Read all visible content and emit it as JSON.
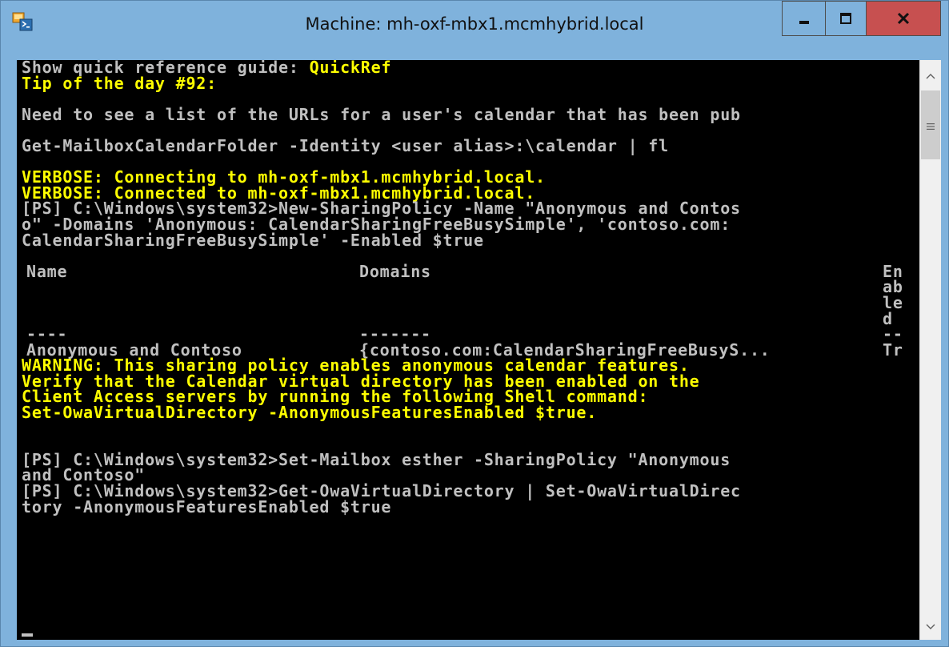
{
  "window": {
    "title": "Machine: mh-oxf-mbx1.mcmhybrid.local",
    "icon": "powershell-console-icon",
    "controls": [
      "minimize-icon",
      "maximize-icon",
      "close-icon"
    ],
    "colors": {
      "titlebar": "#7fb2dc",
      "close": "#c75050",
      "console_bg": "#000000",
      "text_default": "#c0c0c0",
      "text_yellow": "#ffff00"
    }
  },
  "console": {
    "lines": [
      {
        "segments": [
          {
            "text": "Show quick reference guide: ",
            "color": "w"
          },
          {
            "text": "QuickRef",
            "color": "y"
          }
        ]
      },
      {
        "segments": [
          {
            "text": "Tip of the day #92:",
            "color": "y"
          }
        ]
      },
      {
        "segments": []
      },
      {
        "segments": [
          {
            "text": "Need to see a list of the URLs for a user's calendar that has been pub",
            "color": "w"
          }
        ]
      },
      {
        "segments": []
      },
      {
        "segments": [
          {
            "text": "Get-MailboxCalendarFolder -Identity <user alias>:\\calendar | fl",
            "color": "w"
          }
        ]
      },
      {
        "segments": []
      },
      {
        "segments": [
          {
            "text": "VERBOSE: Connecting to mh-oxf-mbx1.mcmhybrid.local.",
            "color": "y"
          }
        ]
      },
      {
        "segments": [
          {
            "text": "VERBOSE: Connected to mh-oxf-mbx1.mcmhybrid.local.",
            "color": "y"
          }
        ]
      },
      {
        "segments": [
          {
            "text": "[PS] C:\\Windows\\system32>New-SharingPolicy -Name \"Anonymous and Contos",
            "color": "w"
          }
        ]
      },
      {
        "segments": [
          {
            "text": "o\" -Domains 'Anonymous: CalendarSharingFreeBusySimple', 'contoso.com:",
            "color": "w"
          }
        ]
      },
      {
        "segments": [
          {
            "text": "CalendarSharingFreeBusySimple' -Enabled $true",
            "color": "w"
          }
        ]
      },
      {
        "segments": []
      }
    ],
    "table": {
      "headers": {
        "name": "Name",
        "domains": "Domains",
        "enabled": [
          "En",
          "ab",
          "le",
          "d"
        ]
      },
      "rules": {
        "name": "----",
        "domains": "-------",
        "enabled": "--"
      },
      "row": {
        "name": "Anonymous and Contoso",
        "domains": "{contoso.com:CalendarSharingFreeBusyS...",
        "enabled": "Tr"
      }
    },
    "lines_after": [
      {
        "segments": [
          {
            "text": "WARNING: This sharing policy enables anonymous calendar features.",
            "color": "y"
          }
        ]
      },
      {
        "segments": [
          {
            "text": "Verify that the Calendar virtual directory has been enabled on the",
            "color": "y"
          }
        ]
      },
      {
        "segments": [
          {
            "text": "Client Access servers by running the following Shell command:",
            "color": "y"
          }
        ]
      },
      {
        "segments": [
          {
            "text": "Set-OwaVirtualDirectory -AnonymousFeaturesEnabled $true.",
            "color": "y"
          }
        ]
      },
      {
        "segments": []
      },
      {
        "segments": []
      },
      {
        "segments": [
          {
            "text": "[PS] C:\\Windows\\system32>Set-Mailbox esther -SharingPolicy \"Anonymous",
            "color": "w"
          }
        ]
      },
      {
        "segments": [
          {
            "text": "and Contoso\"",
            "color": "w"
          }
        ]
      },
      {
        "segments": [
          {
            "text": "[PS] C:\\Windows\\system32>Get-OwaVirtualDirectory | Set-OwaVirtualDirec",
            "color": "w"
          }
        ]
      },
      {
        "segments": [
          {
            "text": "tory -AnonymousFeaturesEnabled $true",
            "color": "w"
          }
        ]
      }
    ]
  },
  "scrollbar": {
    "up_icon": "chevron-up-icon",
    "down_icon": "chevron-down-icon",
    "thumb_icon": "grip-icon"
  }
}
